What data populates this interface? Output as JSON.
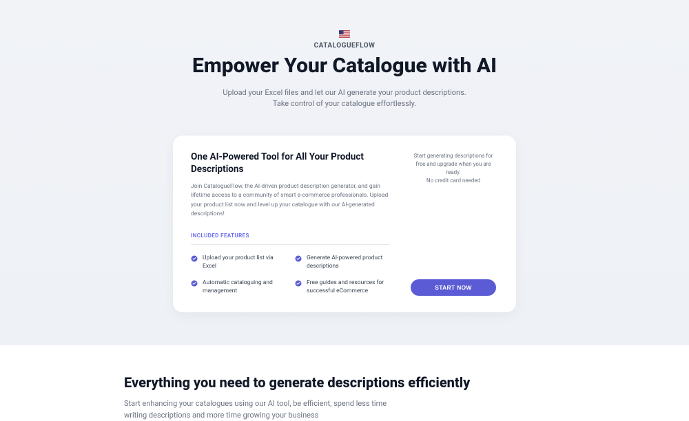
{
  "header": {
    "brand": "CATALOGUEFLOW",
    "headline": "Empower Your Catalogue with AI",
    "subline1": "Upload your Excel files and let our AI generate your product descriptions.",
    "subline2": "Take control of your catalogue effortlessly."
  },
  "card": {
    "title": "One AI-Powered Tool for All Your Product Descriptions",
    "description": "Join CatalogueFlow, the AI-driven product description generator, and gain lifetime access to a community of smart e-commerce professionals. Upload your product list now and level up your catalogue with our AI-generated descriptions!",
    "features_label": "INCLUDED FEATURES",
    "features": [
      "Upload your product list via Excel",
      "Generate AI-powered product descriptions",
      "Automatic cataloguing and management",
      "Free guides and resources for successful eCommerce"
    ],
    "right_text_line1": "Start generating descriptions for free and upgrade when you are ready.",
    "right_text_line2": "No credit card needed",
    "cta_label": "START NOW"
  },
  "lower": {
    "title": "Everything you need to generate descriptions efficiently",
    "description": "Start enhancing your catalogues using our AI tool, be efficient, spend less time writing descriptions and more time growing your business"
  },
  "colors": {
    "accent": "#5b5bd6"
  }
}
